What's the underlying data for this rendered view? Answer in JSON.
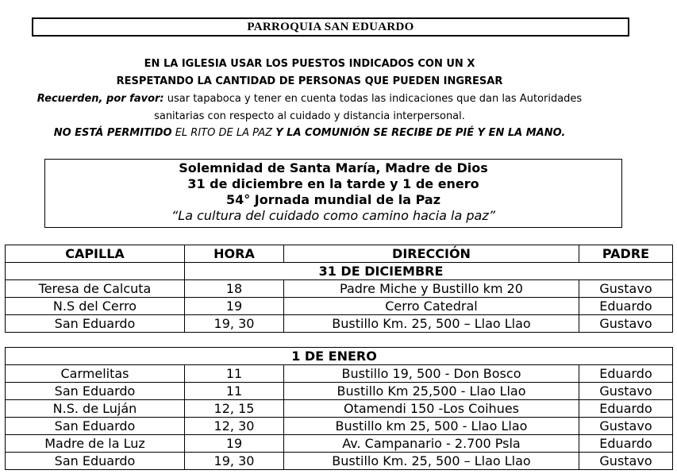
{
  "title": "PARROQUIA SAN EDUARDO",
  "notice": {
    "line1": "EN LA IGLESIA USAR LOS PUESTOS INDICADOS CON UN X",
    "line2": "RESPETANDO LA CANTIDAD DE PERSONAS QUE PUEDEN INGRESAR",
    "line3_lead": "Recuerden, por favor:",
    "line3_rest": " usar tapaboca y tener en cuenta todas las indicaciones que dan las Autoridades",
    "line4": "sanitarias con respecto al cuidado y distancia interpersonal.",
    "line5_a": "NO ESTÁ PERMITIDO",
    "line5_b": " EL RITO DE LA PAZ ",
    "line5_c": "Y LA COMUNIÓN SE RECIBE DE PIÉ Y EN LA MANO."
  },
  "event": {
    "line1": "Solemnidad de Santa María, Madre de Dios",
    "line2": "31 de diciembre en la tarde y 1 de enero",
    "line3": "54° Jornada mundial de la Paz",
    "quote": "“La cultura del cuidado como camino hacia la paz”"
  },
  "columns": [
    "CAPILLA",
    "HORA",
    "DIRECCIÓN",
    "PADRE"
  ],
  "section1": {
    "label": "31 DE DICIEMBRE",
    "rows": [
      [
        "Teresa de Calcuta",
        "18",
        "Padre Miche y Bustillo km 20",
        "Gustavo"
      ],
      [
        "N.S del Cerro",
        "19",
        "Cerro Catedral",
        "Eduardo"
      ],
      [
        "San Eduardo",
        "19, 30",
        "Bustillo Km. 25, 500 – Llao Llao",
        "Gustavo"
      ]
    ]
  },
  "section2": {
    "label": "1 DE ENERO",
    "rows": [
      [
        "Carmelitas",
        "11",
        "Bustillo  19, 500  -  Don Bosco",
        "Eduardo"
      ],
      [
        "San Eduardo",
        "11",
        "Bustillo Km 25,500 - Llao Llao",
        "Gustavo"
      ],
      [
        "N.S. de Luján",
        "12, 15",
        "Otamendi 150  -Los Coihues",
        "Eduardo"
      ],
      [
        "San Eduardo",
        "12, 30",
        "Bustillo km 25, 500 - Llao Llao",
        "Gustavo"
      ],
      [
        "Madre de la Luz",
        "19",
        "Av. Campanario - 2.700 Psla",
        "Eduardo"
      ],
      [
        "San Eduardo",
        "19, 30",
        "Bustillo Km. 25, 500 – Llao Llao",
        "Gustavo"
      ]
    ]
  }
}
